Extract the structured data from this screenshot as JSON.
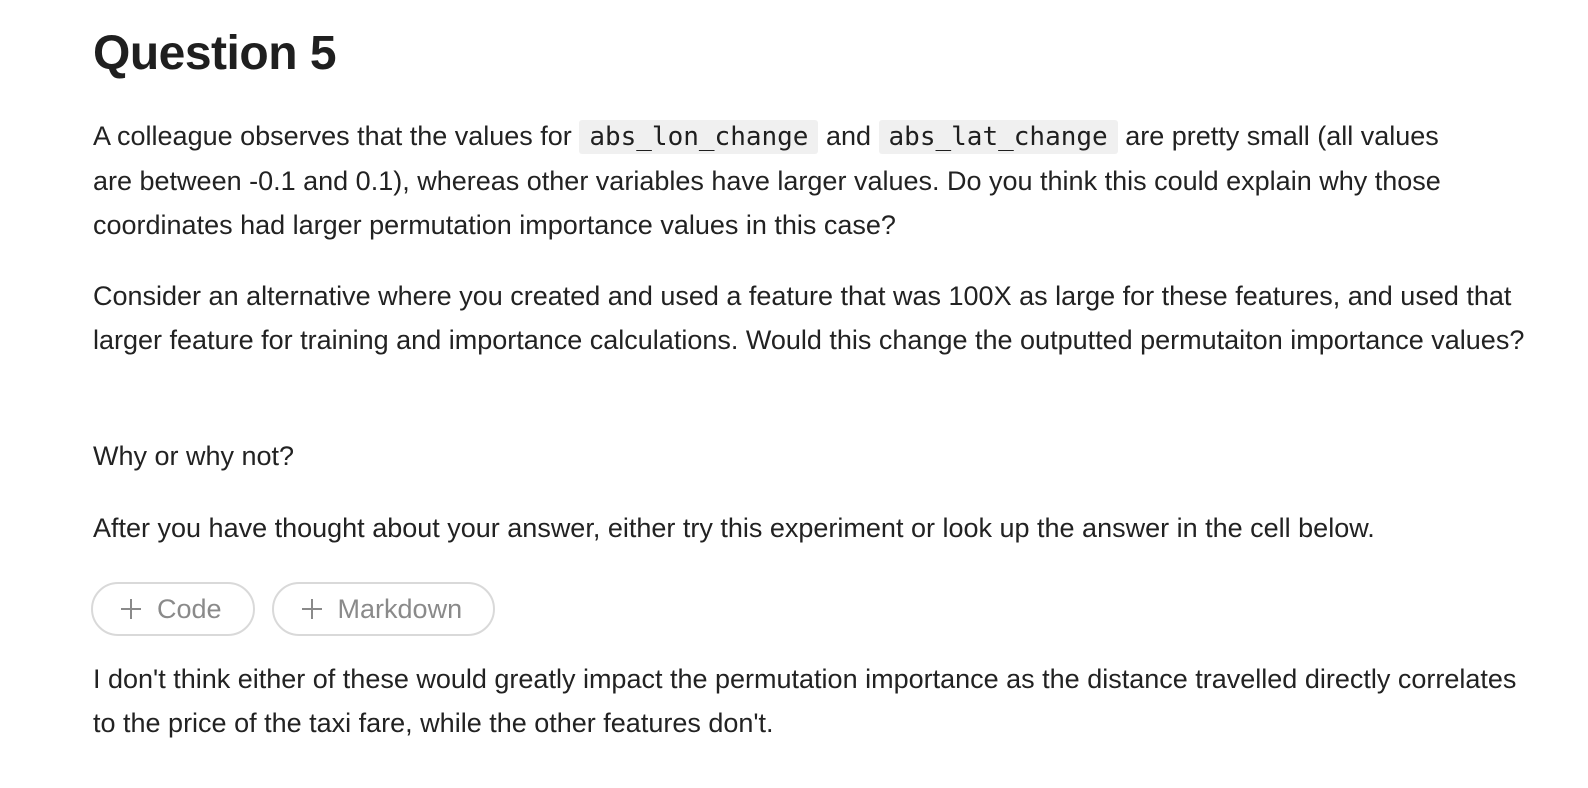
{
  "notebook": {
    "title": "Question 5",
    "paragraph1": {
      "text_a": "A colleague observes that the values for ",
      "code_a": "abs_lon_change",
      "text_b": " and ",
      "code_b": "abs_lat_change",
      "text_c": " are pretty small (all values are between -0.1 and 0.1), whereas other variables have larger values. Do you think this could explain why those coordinates had larger permutation importance values in this case?"
    },
    "paragraph2": "Consider an alternative where you created and used a feature that was 100X as large for these features, and used that larger feature for training and importance calculations. Would this change the outputted permutaiton importance values?",
    "paragraph3": "Why or why not?",
    "paragraph4": "After you have thought about your answer, either try this experiment or look up the answer in the cell below.",
    "add_buttons": {
      "code_label": "Code",
      "markdown_label": "Markdown",
      "icon": "plus-icon"
    },
    "answer": "I don't think either of these would greatly impact the permutation importance as the distance travelled directly correlates to the price of the taxi fare, while the other features don't."
  }
}
